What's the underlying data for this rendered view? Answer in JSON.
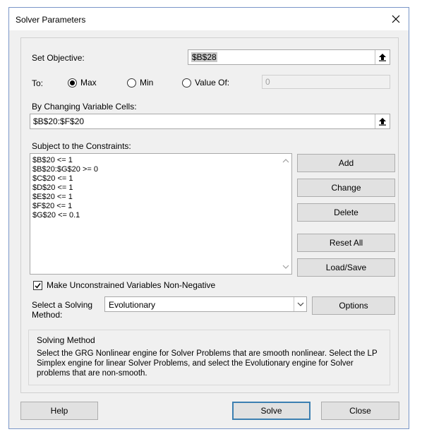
{
  "window": {
    "title": "Solver Parameters"
  },
  "objective": {
    "label": "Set Objective:",
    "value": "$B$28"
  },
  "to": {
    "label": "To:",
    "max_label": "Max",
    "min_label": "Min",
    "value_of_label": "Value Of:",
    "value_of_field": "0",
    "selected": "Max"
  },
  "changing": {
    "label": "By Changing Variable Cells:",
    "value": "$B$20:$F$20"
  },
  "constraints": {
    "label": "Subject to the Constraints:",
    "items": [
      "$B$20 <= 1",
      "$B$20:$G$20 >= 0",
      "$C$20 <= 1",
      "$D$20 <= 1",
      "$E$20 <= 1",
      "$F$20 <= 1",
      "$G$20 <= 0.1"
    ]
  },
  "buttons": {
    "add": "Add",
    "change": "Change",
    "delete": "Delete",
    "reset_all": "Reset All",
    "load_save": "Load/Save",
    "options": "Options",
    "help": "Help",
    "solve": "Solve",
    "close": "Close"
  },
  "nonneg": {
    "label": "Make Unconstrained Variables Non-Negative",
    "checked": true
  },
  "method": {
    "label_line1": "Select a Solving",
    "label_line2": "Method:",
    "value": "Evolutionary"
  },
  "solving_method": {
    "title": "Solving Method",
    "description": "Select the GRG Nonlinear engine for Solver Problems that are smooth nonlinear. Select the LP Simplex engine for linear Solver Problems, and select the Evolutionary engine for Solver problems that are non-smooth."
  },
  "icons": {
    "ref_button": "collapse-dialog-icon",
    "close": "close-icon"
  }
}
